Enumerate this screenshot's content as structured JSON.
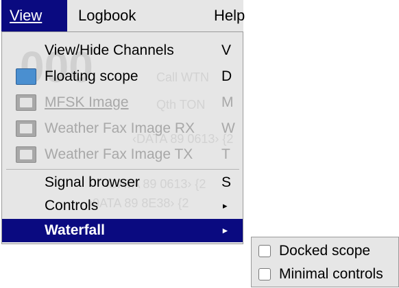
{
  "menubar": {
    "items": [
      {
        "label": "View"
      },
      {
        "label": "Logbook"
      },
      {
        "label": "Help"
      }
    ]
  },
  "view_menu": {
    "items": [
      {
        "label": "View/Hide Channels",
        "shortcut": "V",
        "icon": null,
        "enabled": true
      },
      {
        "label": "Floating scope",
        "shortcut": "D",
        "icon": "scope-icon",
        "enabled": true
      },
      {
        "label": "MFSK Image",
        "shortcut": "M",
        "icon": "image-icon",
        "enabled": false
      },
      {
        "label": "Weather Fax Image RX",
        "shortcut": "W",
        "icon": "image-icon",
        "enabled": false
      },
      {
        "label": "Weather Fax Image TX",
        "shortcut": "T",
        "icon": "image-icon",
        "enabled": false
      },
      {
        "label": "Signal browser",
        "shortcut": "S",
        "enabled": true
      },
      {
        "label": "Controls",
        "submenu": true,
        "enabled": true
      },
      {
        "label": "Waterfall",
        "submenu": true,
        "enabled": true,
        "selected": true
      }
    ],
    "arrow_glyph": "▸"
  },
  "waterfall_submenu": {
    "items": [
      {
        "label": "Docked scope",
        "checked": false
      },
      {
        "label": "Minimal controls",
        "checked": false
      }
    ]
  },
  "colors": {
    "menu_bg": "#e6e6e6",
    "highlight": "#0a0a80",
    "disabled_text": "#a8a8a8"
  }
}
